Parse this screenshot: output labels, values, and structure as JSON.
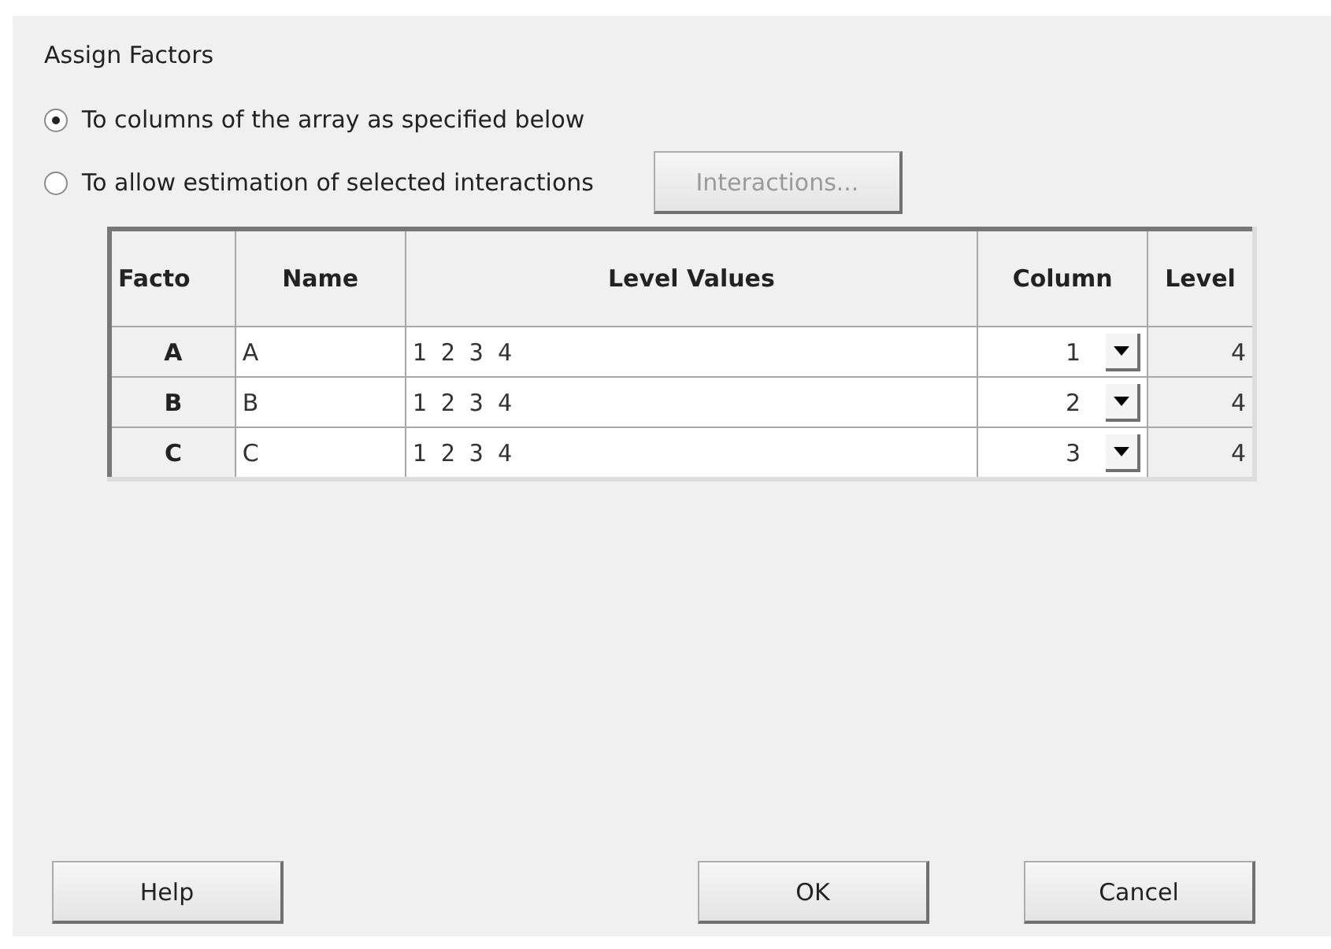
{
  "group_title": "Assign Factors",
  "options": [
    {
      "label": "To columns of the array as specified below",
      "selected": true
    },
    {
      "label": "To allow estimation of selected interactions",
      "selected": false
    }
  ],
  "interactions_button": {
    "label": "Interactions...",
    "disabled": true
  },
  "table": {
    "columns": [
      "Facto",
      "Name",
      "Level Values",
      "Column",
      "Level"
    ],
    "rows": [
      {
        "factor": "A",
        "name": "A",
        "level_values": "1 2 3 4",
        "column": "1",
        "level": "4"
      },
      {
        "factor": "B",
        "name": "B",
        "level_values": "1 2 3 4",
        "column": "2",
        "level": "4"
      },
      {
        "factor": "C",
        "name": "C",
        "level_values": "1 2 3 4",
        "column": "3",
        "level": "4"
      }
    ]
  },
  "buttons": [
    "Help",
    "OK",
    "Cancel"
  ]
}
